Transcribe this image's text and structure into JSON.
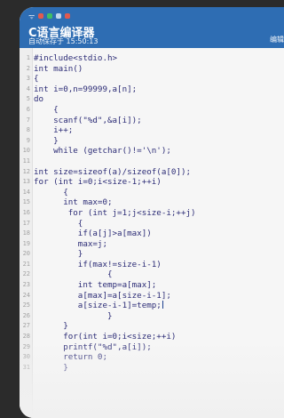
{
  "status": {
    "indicators": [
      {
        "name": "signal-icon",
        "color": "#eaf2ff"
      },
      {
        "name": "app-icon-1",
        "color": "#e25a4e"
      },
      {
        "name": "app-icon-2",
        "color": "#3fbf63"
      },
      {
        "name": "app-icon-3",
        "color": "#c4d6ee"
      },
      {
        "name": "app-icon-4",
        "color": "#e25a4e"
      }
    ]
  },
  "appbar": {
    "title": "C语言编译器",
    "subtitle": "自动保存于 15:50:13",
    "action": "编辑",
    "color": "#2e6db3"
  },
  "editor": {
    "lines": [
      {
        "n": "1",
        "text": "#include<stdio.h>"
      },
      {
        "n": "2",
        "text": "int main()"
      },
      {
        "n": "3",
        "text": "{"
      },
      {
        "n": "4",
        "text": "int i=0,n=99999,a[n];"
      },
      {
        "n": "5",
        "text": "do"
      },
      {
        "n": "6",
        "text": "    {"
      },
      {
        "n": "7",
        "text": "    scanf(\"%d\",&a[i]);"
      },
      {
        "n": "8",
        "text": "    i++;"
      },
      {
        "n": "9",
        "text": "    }"
      },
      {
        "n": "10",
        "text": "    while (getchar()!='\\n');"
      },
      {
        "n": "11",
        "text": ""
      },
      {
        "n": "12",
        "text": "int size=sizeof(a)/sizeof(a[0]);"
      },
      {
        "n": "13",
        "text": "for (int i=0;i<size-1;++i)"
      },
      {
        "n": "14",
        "text": "      {"
      },
      {
        "n": "15",
        "text": "      int max=0;"
      },
      {
        "n": "16",
        "text": "       for (int j=1;j<size-i;++j)"
      },
      {
        "n": "17",
        "text": "         {"
      },
      {
        "n": "18",
        "text": "         if(a[j]>a[max])"
      },
      {
        "n": "19",
        "text": "         max=j;"
      },
      {
        "n": "20",
        "text": "         }"
      },
      {
        "n": "21",
        "text": "         if(max!=size-i-1)"
      },
      {
        "n": "22",
        "text": "               {"
      },
      {
        "n": "23",
        "text": "         int temp=a[max];"
      },
      {
        "n": "24",
        "text": "         a[max]=a[size-i-1];"
      },
      {
        "n": "25",
        "text": "         a[size-i-1]=temp;"
      },
      {
        "n": "26",
        "text": "               }"
      },
      {
        "n": "27",
        "text": "      }"
      },
      {
        "n": "28",
        "text": "      for(int i=0;i<size;++i)"
      },
      {
        "n": "29",
        "text": "      printf(\"%d\",a[i]);"
      },
      {
        "n": "30",
        "text": "      return 0;"
      },
      {
        "n": "31",
        "text": "      }"
      }
    ]
  }
}
